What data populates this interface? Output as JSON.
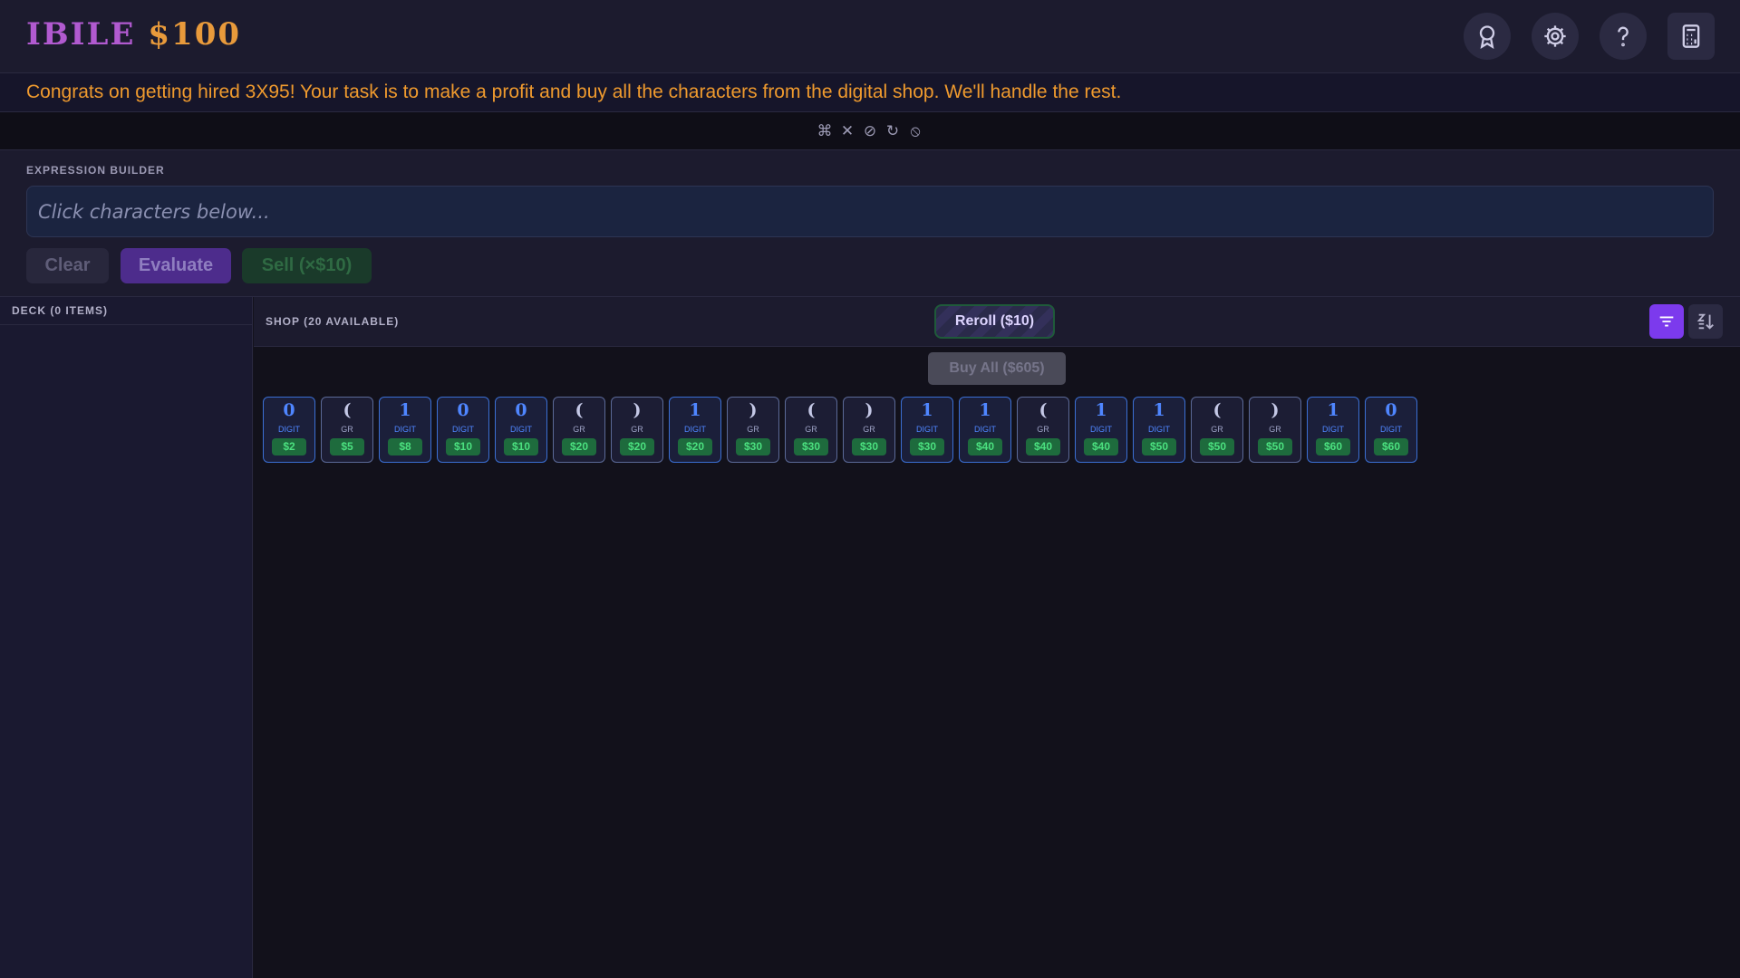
{
  "header": {
    "brand_name": "IBILE",
    "brand_money": "$100",
    "icons": [
      "award-icon",
      "gear-icon",
      "help-icon",
      "calculator-icon"
    ]
  },
  "banner": {
    "text": "Congrats on getting hired 3X95! Your task is to make a profit and buy all the characters from the digital shop. We'll handle the rest."
  },
  "strip": {
    "icons": [
      "grid-icon",
      "close-icon",
      "ban-icon",
      "refresh-icon",
      "timer-off-icon"
    ],
    "glyphs": [
      "⌘",
      "✕",
      "⊘",
      "↻",
      "⦸"
    ]
  },
  "builder": {
    "label": "EXPRESSION BUILDER",
    "placeholder": "Click characters below...",
    "clear_label": "Clear",
    "evaluate_label": "Evaluate",
    "sell_label": "Sell (×$10)"
  },
  "deck": {
    "label": "DECK (0 ITEMS)"
  },
  "shop": {
    "label": "SHOP (20 AVAILABLE)",
    "reroll_label": "Reroll ($10)",
    "buy_all_label": "Buy All ($605)",
    "items": [
      {
        "symbol": "0",
        "type": "DIGIT",
        "price": "$2"
      },
      {
        "symbol": "(",
        "type": "GR",
        "price": "$5"
      },
      {
        "symbol": "1",
        "type": "DIGIT",
        "price": "$8"
      },
      {
        "symbol": "0",
        "type": "DIGIT",
        "price": "$10"
      },
      {
        "symbol": "0",
        "type": "DIGIT",
        "price": "$10"
      },
      {
        "symbol": "(",
        "type": "GR",
        "price": "$20"
      },
      {
        "symbol": ")",
        "type": "GR",
        "price": "$20"
      },
      {
        "symbol": "1",
        "type": "DIGIT",
        "price": "$20"
      },
      {
        "symbol": ")",
        "type": "GR",
        "price": "$30"
      },
      {
        "symbol": "(",
        "type": "GR",
        "price": "$30"
      },
      {
        "symbol": ")",
        "type": "GR",
        "price": "$30"
      },
      {
        "symbol": "1",
        "type": "DIGIT",
        "price": "$30"
      },
      {
        "symbol": "1",
        "type": "DIGIT",
        "price": "$40"
      },
      {
        "symbol": "(",
        "type": "GR",
        "price": "$40"
      },
      {
        "symbol": "1",
        "type": "DIGIT",
        "price": "$40"
      },
      {
        "symbol": "1",
        "type": "DIGIT",
        "price": "$50"
      },
      {
        "symbol": "(",
        "type": "GR",
        "price": "$50"
      },
      {
        "symbol": ")",
        "type": "GR",
        "price": "$50"
      },
      {
        "symbol": "1",
        "type": "DIGIT",
        "price": "$60"
      },
      {
        "symbol": "0",
        "type": "DIGIT",
        "price": "$60"
      }
    ]
  },
  "colors": {
    "accent": "#7c3aed",
    "brand_name": "#b15ad0",
    "brand_money": "#e89a3b",
    "banner_text": "#ef9a2e",
    "digit": "#4f86ff",
    "price": "#4be07f"
  }
}
